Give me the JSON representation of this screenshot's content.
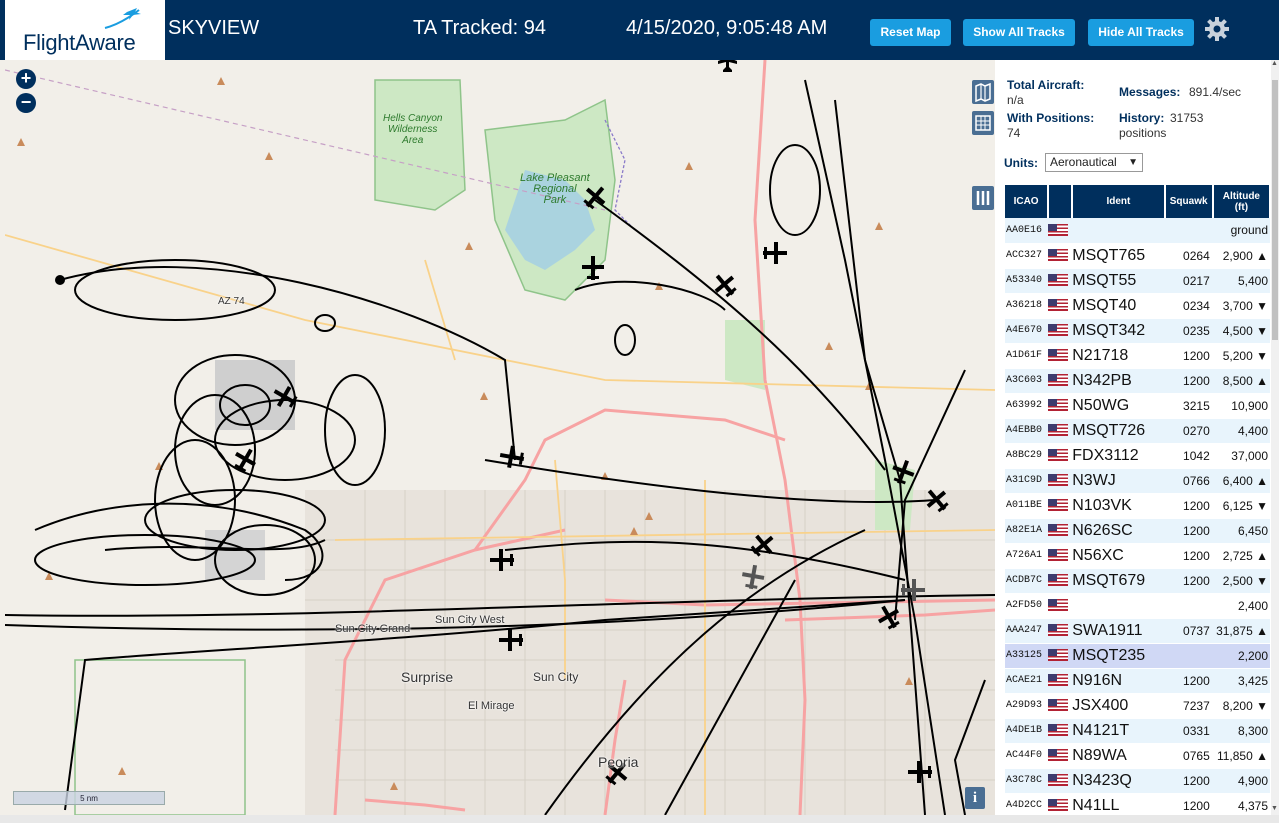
{
  "header": {
    "logo_text": "FlightAware",
    "app_name": "SKYVIEW",
    "tracked": "TA Tracked: 94",
    "datetime": "4/15/2020, 9:05:48 AM",
    "reset_map": "Reset Map",
    "show_all_tracks": "Show All Tracks",
    "hide_all_tracks": "Hide All Tracks",
    "gear_icon": "gear-icon"
  },
  "map": {
    "zoom_in": "+",
    "zoom_out": "−",
    "scale": "5 nm",
    "info": "i",
    "labels": {
      "hells_canyon": "Hells Canyon\nWilderness\nArea",
      "lake_pleasant": "Lake Pleasant\nRegional\nPark",
      "az74": "AZ 74",
      "sun_city_grand": "Sun City Grand",
      "sun_city_west": "Sun City West",
      "surprise": "Surprise",
      "sun_city": "Sun City",
      "el_mirage": "El Mirage",
      "peoria": "Peoria"
    }
  },
  "stats": {
    "total_aircraft_label": "Total Aircraft:",
    "total_aircraft_value": "n/a",
    "with_positions_label": "With Positions:",
    "with_positions_value": "74",
    "messages_label": "Messages:",
    "messages_value": "891.4/sec",
    "history_label": "History:",
    "history_value": "31753",
    "history_unit": "positions",
    "units_label": "Units:",
    "units_value": "Aeronautical"
  },
  "table": {
    "headers": {
      "icao": "ICAO",
      "ident": "Ident",
      "squawk": "Squawk",
      "altitude": "Altitude",
      "altitude_unit": "(ft)"
    },
    "rows": [
      {
        "icao": "AA0E16",
        "ident": "",
        "squawk": "",
        "alt": "ground"
      },
      {
        "icao": "ACC327",
        "ident": "MSQT765",
        "squawk": "0264",
        "alt": "2,900 ▲"
      },
      {
        "icao": "A53340",
        "ident": "MSQT55",
        "squawk": "0217",
        "alt": "5,400"
      },
      {
        "icao": "A36218",
        "ident": "MSQT40",
        "squawk": "0234",
        "alt": "3,700 ▼"
      },
      {
        "icao": "A4E670",
        "ident": "MSQT342",
        "squawk": "0235",
        "alt": "4,500 ▼"
      },
      {
        "icao": "A1D61F",
        "ident": "N21718",
        "squawk": "1200",
        "alt": "5,200 ▼"
      },
      {
        "icao": "A3C603",
        "ident": "N342PB",
        "squawk": "1200",
        "alt": "8,500 ▲"
      },
      {
        "icao": "A63992",
        "ident": "N50WG",
        "squawk": "3215",
        "alt": "10,900"
      },
      {
        "icao": "A4EBB0",
        "ident": "MSQT726",
        "squawk": "0270",
        "alt": "4,400"
      },
      {
        "icao": "A8BC29",
        "ident": "FDX3112",
        "squawk": "1042",
        "alt": "37,000"
      },
      {
        "icao": "A31C9D",
        "ident": "N3WJ",
        "squawk": "0766",
        "alt": "6,400 ▲"
      },
      {
        "icao": "A011BE",
        "ident": "N103VK",
        "squawk": "1200",
        "alt": "6,125 ▼"
      },
      {
        "icao": "A82E1A",
        "ident": "N626SC",
        "squawk": "1200",
        "alt": "6,450"
      },
      {
        "icao": "A726A1",
        "ident": "N56XC",
        "squawk": "1200",
        "alt": "2,725 ▲"
      },
      {
        "icao": "ACDB7C",
        "ident": "MSQT679",
        "squawk": "1200",
        "alt": "2,500 ▼"
      },
      {
        "icao": "A2FD50",
        "ident": "",
        "squawk": "",
        "alt": "2,400"
      },
      {
        "icao": "AAA247",
        "ident": "SWA1911",
        "squawk": "0737",
        "alt": "31,875 ▲"
      },
      {
        "icao": "A33125",
        "ident": "MSQT235",
        "squawk": "",
        "alt": "2,200"
      },
      {
        "icao": "ACAE21",
        "ident": "N916N",
        "squawk": "1200",
        "alt": "3,425"
      },
      {
        "icao": "A29D93",
        "ident": "JSX400",
        "squawk": "7237",
        "alt": "8,200 ▼"
      },
      {
        "icao": "A4DE1B",
        "ident": "N4121T",
        "squawk": "0331",
        "alt": "8,300"
      },
      {
        "icao": "AC44F0",
        "ident": "N89WA",
        "squawk": "0765",
        "alt": "11,850 ▲"
      },
      {
        "icao": "A3C78C",
        "ident": "N3423Q",
        "squawk": "1200",
        "alt": "4,900"
      },
      {
        "icao": "A4D2CC",
        "ident": "N41LL",
        "squawk": "1200",
        "alt": "4,375"
      }
    ]
  },
  "colors": {
    "header_bg": "#002f5d",
    "button_bg": "#1a9de0",
    "row_alt": "#e8f4fc",
    "row_selected": "#d0d8f5"
  }
}
